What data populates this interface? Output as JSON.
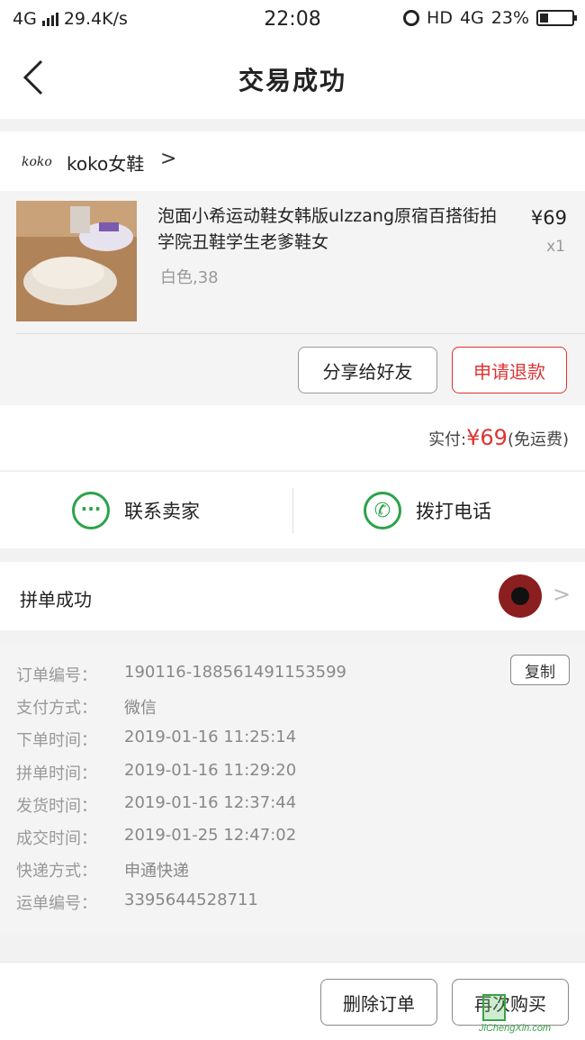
{
  "status_bar": {
    "network": "4G",
    "speed": "29.4K/s",
    "time": "22:08",
    "hd": "HD",
    "network2": "4G",
    "battery": "23%"
  },
  "nav": {
    "title": "交易成功"
  },
  "shop": {
    "logo_text": "koko",
    "name": "koko女鞋",
    "arrow": ">"
  },
  "product": {
    "title": "泡面小希运动鞋女韩版ulzzang原宿百搭街拍学院丑鞋学生老爹鞋女",
    "spec": "白色,38",
    "price": "¥69",
    "qty": "x1",
    "share_label": "分享给好友",
    "refund_label": "申请退款"
  },
  "payment": {
    "label": "实付:",
    "amount": "¥69",
    "note": "(免运费)"
  },
  "contact": {
    "seller_label": "联系卖家",
    "call_label": "拨打电话"
  },
  "group": {
    "label": "拼单成功",
    "arrow": ">"
  },
  "order_details": [
    {
      "key": "订单编号：",
      "value": "190116-188561491153599"
    },
    {
      "key": "支付方式：",
      "value": "微信"
    },
    {
      "key": "下单时间：",
      "value": "2019-01-16 11:25:14"
    },
    {
      "key": "拼单时间：",
      "value": "2019-01-16 11:29:20"
    },
    {
      "key": "发货时间：",
      "value": "2019-01-16 12:37:44"
    },
    {
      "key": "成交时间：",
      "value": "2019-01-25 12:47:02"
    },
    {
      "key": "快递方式：",
      "value": "申通快递"
    },
    {
      "key": "运单编号：",
      "value": "3395644528711"
    }
  ],
  "copy_label": "复制",
  "footer": {
    "delete_label": "删除订单",
    "rebuy_label": "再次购买"
  },
  "watermark": {
    "text": "JiChengXin.com"
  },
  "colors": {
    "accent_red": "#d33333",
    "wechat_green": "#2ca34a"
  }
}
